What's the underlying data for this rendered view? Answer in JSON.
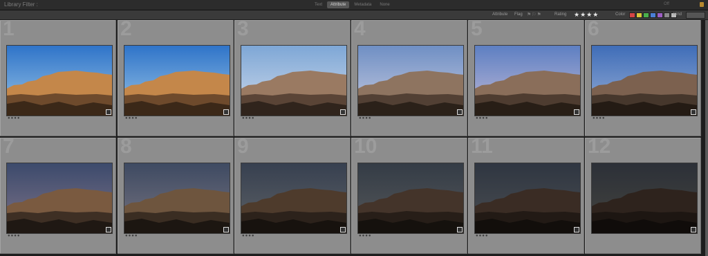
{
  "header": {
    "title": "Library Filter :",
    "preset": "Off",
    "tabs": [
      "Text",
      "Attribute",
      "Metadata",
      "None"
    ],
    "active_tab": "Attribute"
  },
  "attribute_bar": {
    "label": "Attribute",
    "flag_label": "Flag",
    "rating_label": "Rating",
    "rating_stars": "★★★★",
    "color_label": "Color",
    "kind_label": "Kind"
  },
  "swatch_colors": [
    "#d54545",
    "#d9c63a",
    "#4ab04b",
    "#4a7fd6",
    "#9d5ec4",
    "#8a8a8a",
    "#bbbbbb"
  ],
  "grid": {
    "cells": [
      {
        "number": "1",
        "sky_top": "#2f74c9",
        "sky_bottom": "#9cc6e6",
        "rock": "#c4874a",
        "ground": "#6e4a2c",
        "shadow": "#3b2818",
        "dots": "●●●●"
      },
      {
        "number": "2",
        "sky_top": "#2f74c9",
        "sky_bottom": "#9cc6e6",
        "rock": "#c4874a",
        "ground": "#6e4a2c",
        "shadow": "#3b2818",
        "dots": "●●●●"
      },
      {
        "number": "3",
        "sky_top": "#7ea7d6",
        "sky_bottom": "#cfdaea",
        "rock": "#9a7a62",
        "ground": "#5a4436",
        "shadow": "#30241c",
        "dots": "●●●●"
      },
      {
        "number": "4",
        "sky_top": "#6f8fc4",
        "sky_bottom": "#c8cce0",
        "rock": "#8e7460",
        "ground": "#524034",
        "shadow": "#2b2119",
        "dots": "●●●●"
      },
      {
        "number": "5",
        "sky_top": "#5d7fc2",
        "sky_bottom": "#c4bcd8",
        "rock": "#8a6e5a",
        "ground": "#4e3c30",
        "shadow": "#281e16",
        "dots": "●●●●"
      },
      {
        "number": "6",
        "sky_top": "#3f6db8",
        "sky_bottom": "#9ab0d6",
        "rock": "#7c614f",
        "ground": "#46372c",
        "shadow": "#241b14",
        "dots": "●●●●"
      },
      {
        "number": "7",
        "sky_top": "#3c4a6c",
        "sky_bottom": "#7f7488",
        "rock": "#7a5a40",
        "ground": "#3e2f24",
        "shadow": "#1f1813",
        "dots": "●●●●"
      },
      {
        "number": "8",
        "sky_top": "#3e4a62",
        "sky_bottom": "#777480",
        "rock": "#6e553e",
        "ground": "#3a2d22",
        "shadow": "#1c1611",
        "dots": "●●●●"
      },
      {
        "number": "9",
        "sky_top": "#374050",
        "sky_bottom": "#5e6266",
        "rock": "#4e3b2c",
        "ground": "#2c221b",
        "shadow": "#17120e",
        "dots": "●●●●"
      },
      {
        "number": "10",
        "sky_top": "#343c46",
        "sky_bottom": "#56585a",
        "rock": "#44342a",
        "ground": "#271e18",
        "shadow": "#15110d",
        "dots": "●●●●"
      },
      {
        "number": "11",
        "sky_top": "#2f3641",
        "sky_bottom": "#4b4e52",
        "rock": "#3a2c24",
        "ground": "#221a15",
        "shadow": "#120e0b",
        "dots": "●●●●"
      },
      {
        "number": "12",
        "sky_top": "#2c3038",
        "sky_bottom": "#45453f",
        "rock": "#2e231d",
        "ground": "#1d1612",
        "shadow": "#100c0a",
        "dots": ""
      }
    ]
  }
}
